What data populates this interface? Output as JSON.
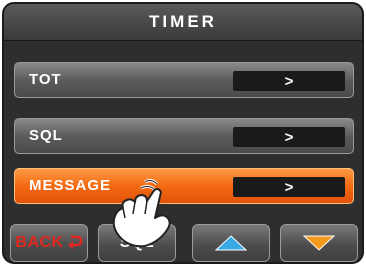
{
  "header": {
    "title": "TIMER"
  },
  "menu": {
    "items": [
      {
        "label": "TOT",
        "arrow": ">"
      },
      {
        "label": "SQL",
        "arrow": ">"
      },
      {
        "label": "MESSAGE",
        "arrow": ">",
        "selected": true
      }
    ]
  },
  "softkeys": {
    "back": "BACK",
    "sql": "SQL",
    "up_icon": "triangle-up-icon",
    "down_icon": "triangle-down-icon"
  },
  "colors": {
    "selected": "#f36a12",
    "arrow_up": "#39a9e6",
    "arrow_down": "#f39b1c",
    "back_text": "#e0281e"
  }
}
